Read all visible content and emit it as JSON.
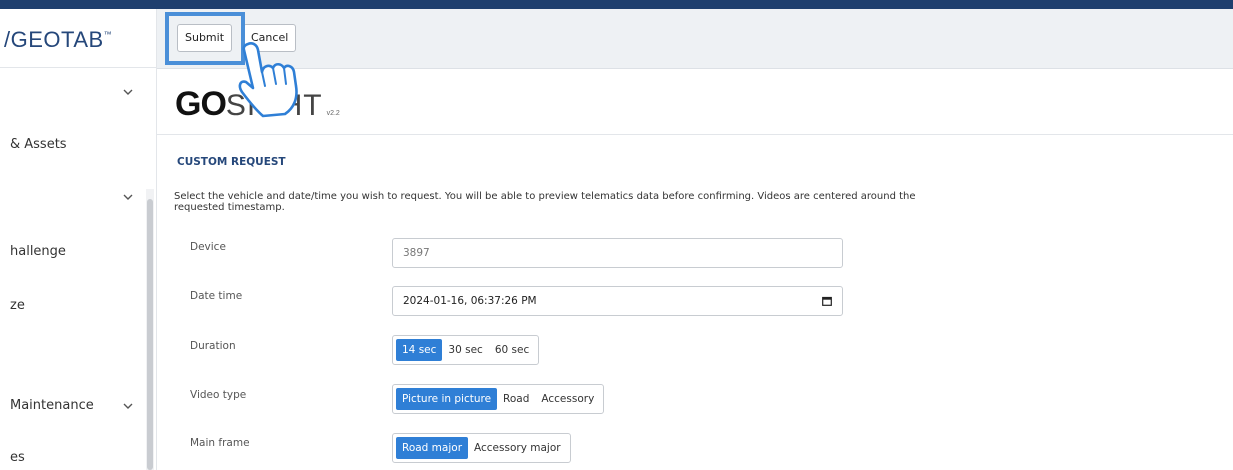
{
  "sidebar": {
    "brand": "/GEOTAB",
    "brand_mark": "™",
    "items": [
      {
        "label": "& Assets"
      },
      {
        "label": "hallenge"
      },
      {
        "label": "ze"
      },
      {
        "label": "Maintenance"
      },
      {
        "label": "es"
      }
    ]
  },
  "toolbar": {
    "submit_label": "Submit",
    "cancel_label": "Cancel"
  },
  "logo": {
    "main": "GO",
    "sight": "SIGHT",
    "version": "v2.2"
  },
  "form": {
    "section_title": "CUSTOM REQUEST",
    "description": "Select the vehicle and date/time you wish to request. You will be able to preview telematics data before confirming. Videos are centered around the requested timestamp.",
    "device": {
      "label": "Device",
      "placeholder": "3897"
    },
    "datetime": {
      "label": "Date time",
      "value": "2024-01-16, 06:37:26 PM"
    },
    "duration": {
      "label": "Duration",
      "options": [
        "14 sec",
        "30 sec",
        "60 sec"
      ],
      "selected": "14 sec"
    },
    "video_type": {
      "label": "Video type",
      "options": [
        "Picture in picture",
        "Road",
        "Accessory"
      ],
      "selected": "Picture in picture"
    },
    "main_frame": {
      "label": "Main frame",
      "options": [
        "Road major",
        "Accessory major"
      ],
      "selected": "Road major"
    }
  },
  "colors": {
    "accent": "#2f7fd6",
    "brand": "#25477a",
    "highlight": "#4a8fd8",
    "topbar": "#1f3f6e"
  },
  "icons": [
    "chevron-down-icon",
    "calendar-icon",
    "pointing-hand-icon"
  ]
}
